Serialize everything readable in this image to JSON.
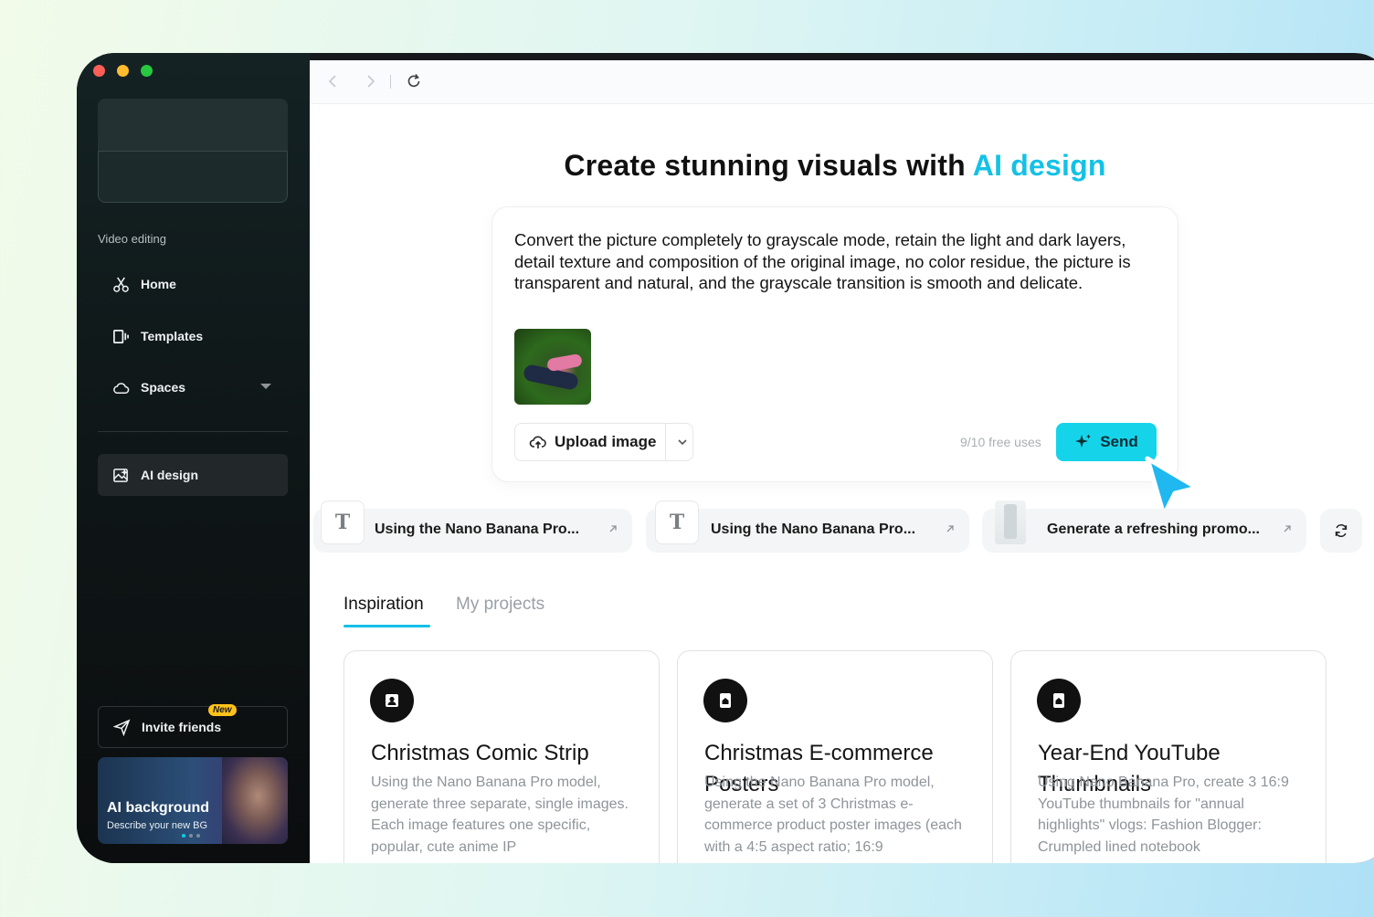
{
  "sidebar": {
    "section_label": "Video editing",
    "nav": [
      {
        "label": "Home",
        "icon": "scissors-icon"
      },
      {
        "label": "Templates",
        "icon": "templates-icon"
      },
      {
        "label": "Spaces",
        "icon": "cloud-icon"
      }
    ],
    "ai_design": {
      "label": "AI design",
      "icon": "image-sparkle-icon"
    },
    "invite": {
      "label": "Invite friends",
      "badge": "New",
      "icon": "send-icon"
    },
    "promo": {
      "title": "AI background",
      "subtitle": "Describe your new BG"
    }
  },
  "headline": {
    "text": "Create stunning visuals with ",
    "accent": "AI design",
    "accent_color": "#14c1e6"
  },
  "prompt": {
    "text": "Convert the picture completely to grayscale mode, retain the light and dark layers, detail texture and composition of the original image, no color residue, the picture is transparent and natural, and the grayscale transition is smooth and delicate.",
    "upload_label": "Upload image",
    "free_uses": "9/10 free uses",
    "send_label": "Send"
  },
  "suggestions": [
    {
      "label": "Using the Nano Banana Pro...",
      "thumb": "text"
    },
    {
      "label": "Using the Nano Banana Pro...",
      "thumb": "text"
    },
    {
      "label": "Generate a refreshing promo...",
      "thumb": "bottle"
    }
  ],
  "tabs": {
    "active": "Inspiration",
    "inactive": "My projects"
  },
  "cards": [
    {
      "title": "Christmas Comic Strip",
      "desc": "Using the Nano Banana Pro model, generate three separate, single images. Each image features one specific, popular, cute anime IP"
    },
    {
      "title": "Christmas E-commerce Posters",
      "desc": "Using the Nano Banana Pro model, generate a set of 3 Christmas e-commerce product poster images (each with a 4:5 aspect ratio; 16:9"
    },
    {
      "title": "Year-End YouTube Thumbnails",
      "desc": "Using Nano Banana Pro, create 3 16:9 YouTube thumbnails for \"annual highlights\" vlogs: Fashion Blogger: Crumpled lined notebook"
    }
  ]
}
